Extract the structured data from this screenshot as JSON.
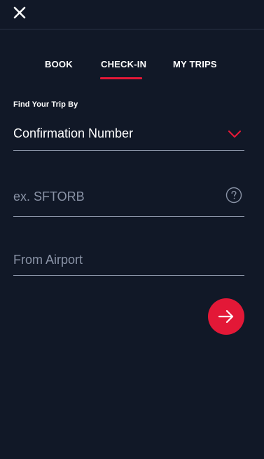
{
  "header": {
    "close_icon": "close-icon"
  },
  "tabs": [
    {
      "label": "BOOK",
      "active": false
    },
    {
      "label": "CHECK-IN",
      "active": true
    },
    {
      "label": "MY TRIPS",
      "active": false
    }
  ],
  "form": {
    "section_label": "Find Your Trip By",
    "trip_lookup_select": {
      "selected_value": "Confirmation Number",
      "icon": "chevron-down-icon"
    },
    "confirmation_input": {
      "value": "",
      "placeholder": "ex. SFTORB",
      "help_icon": "question-circle-icon"
    },
    "airport_input": {
      "value": "",
      "placeholder": "From Airport"
    },
    "submit": {
      "icon": "arrow-right-icon"
    }
  },
  "colors": {
    "background": "#111827",
    "accent": "#e31837",
    "text": "#ffffff",
    "muted": "#8a93a6"
  }
}
